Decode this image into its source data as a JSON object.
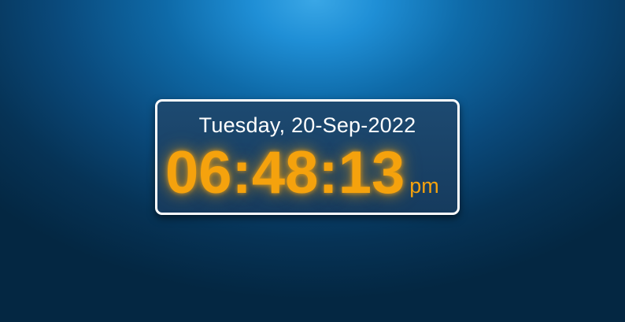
{
  "clock": {
    "date": "Tuesday, 20-Sep-2022",
    "time": "06:48:13",
    "ampm": "pm"
  },
  "colors": {
    "time_accent": "#f5a20d",
    "date_text": "#ffffff",
    "card_border": "#ffffff",
    "card_background": "#1a4468",
    "background_highlight": "#3aa7e6",
    "background_dark": "#042742"
  }
}
